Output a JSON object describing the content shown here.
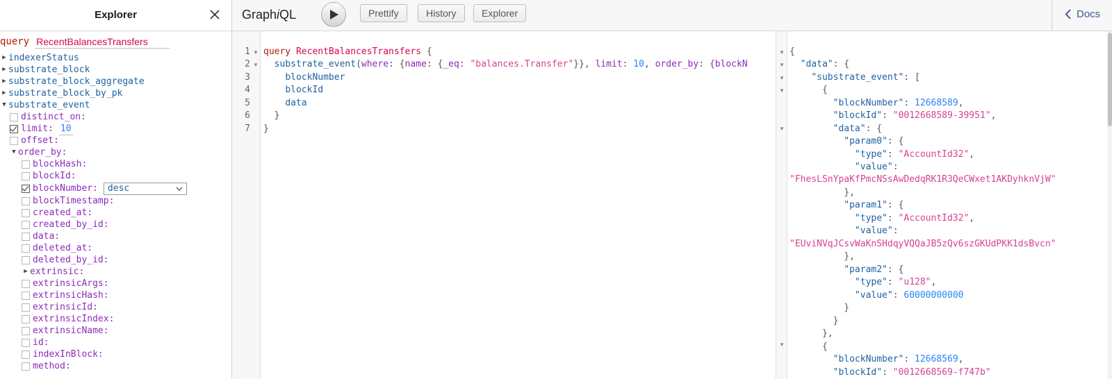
{
  "explorer": {
    "title": "Explorer",
    "query_keyword": "query",
    "query_name": "RecentBalancesTransfers",
    "root_fields": [
      "indexerStatus",
      "substrate_block",
      "substrate_block_aggregate",
      "substrate_block_by_pk"
    ],
    "expanded_field": "substrate_event",
    "args": {
      "distinct_on": "distinct_on:",
      "limit": "limit:",
      "limit_value": "10",
      "offset": "offset:",
      "order_by": "order_by:"
    },
    "order_by_fields": {
      "blockHash": "blockHash:",
      "blockId": "blockId:",
      "blockNumber": "blockNumber:",
      "blockNumber_value": "desc",
      "blockTimestamp": "blockTimestamp:",
      "created_at": "created_at:",
      "created_by_id": "created_by_id:",
      "data": "data:",
      "deleted_at": "deleted_at:",
      "deleted_by_id": "deleted_by_id:",
      "extrinsic": "extrinsic:",
      "extrinsicArgs": "extrinsicArgs:",
      "extrinsicHash": "extrinsicHash:",
      "extrinsicId": "extrinsicId:",
      "extrinsicIndex": "extrinsicIndex:",
      "extrinsicName": "extrinsicName:",
      "id": "id:",
      "indexInBlock": "indexInBlock:",
      "method": "method:"
    }
  },
  "toolbar": {
    "logo_pre": "Graph",
    "logo_i": "i",
    "logo_post": "QL",
    "prettify": "Prettify",
    "history": "History",
    "explorer": "Explorer",
    "docs": "Docs"
  },
  "editor": {
    "line_numbers": [
      "1",
      "2",
      "3",
      "4",
      "5",
      "6",
      "7"
    ],
    "line1": {
      "kw": "query",
      "name": "RecentBalancesTransfers",
      "brace": "{"
    },
    "line2": {
      "field": "substrate_event",
      "open": "(",
      "where": "where",
      "p1": ": {",
      "name_arg": "name",
      "p2": ": {",
      "eq": "_eq",
      "p3": ": ",
      "str": "\"balances.Transfer\"",
      "p4": "}}, ",
      "limit": "limit",
      "p5": ": ",
      "num": "10",
      "p6": ", ",
      "order_by": "order_by",
      "p7": ": {",
      "rest": "blockN"
    },
    "line3": "blockNumber",
    "line4": "blockId",
    "line5": "data",
    "line6": "}",
    "line7": "}"
  },
  "result": {
    "data_key": "\"data\"",
    "event_key": "\"substrate_event\"",
    "bn_key": "\"blockNumber\"",
    "bid_key": "\"blockId\"",
    "d_key": "\"data\"",
    "param0_key": "\"param0\"",
    "param1_key": "\"param1\"",
    "param2_key": "\"param2\"",
    "type_key": "\"type\"",
    "value_key": "\"value\"",
    "bn1": "12668589",
    "bid1": "\"0012668589-39951\"",
    "type0": "\"AccountId32\"",
    "value0": "\"FhesLSnYpaKfPmcNSsAwDedqRK1R3QeCWxet1AKDyhknVjW\"",
    "type1": "\"AccountId32\"",
    "value1": "\"EUviNVqJCsvWaKnSHdqyVQQaJB5zQv6szGKUdPKK1dsBvcn\"",
    "type2": "\"u128\"",
    "value2": "60000000000",
    "bn2": "12668569",
    "bid2": "\"0012668569-f747b\""
  }
}
